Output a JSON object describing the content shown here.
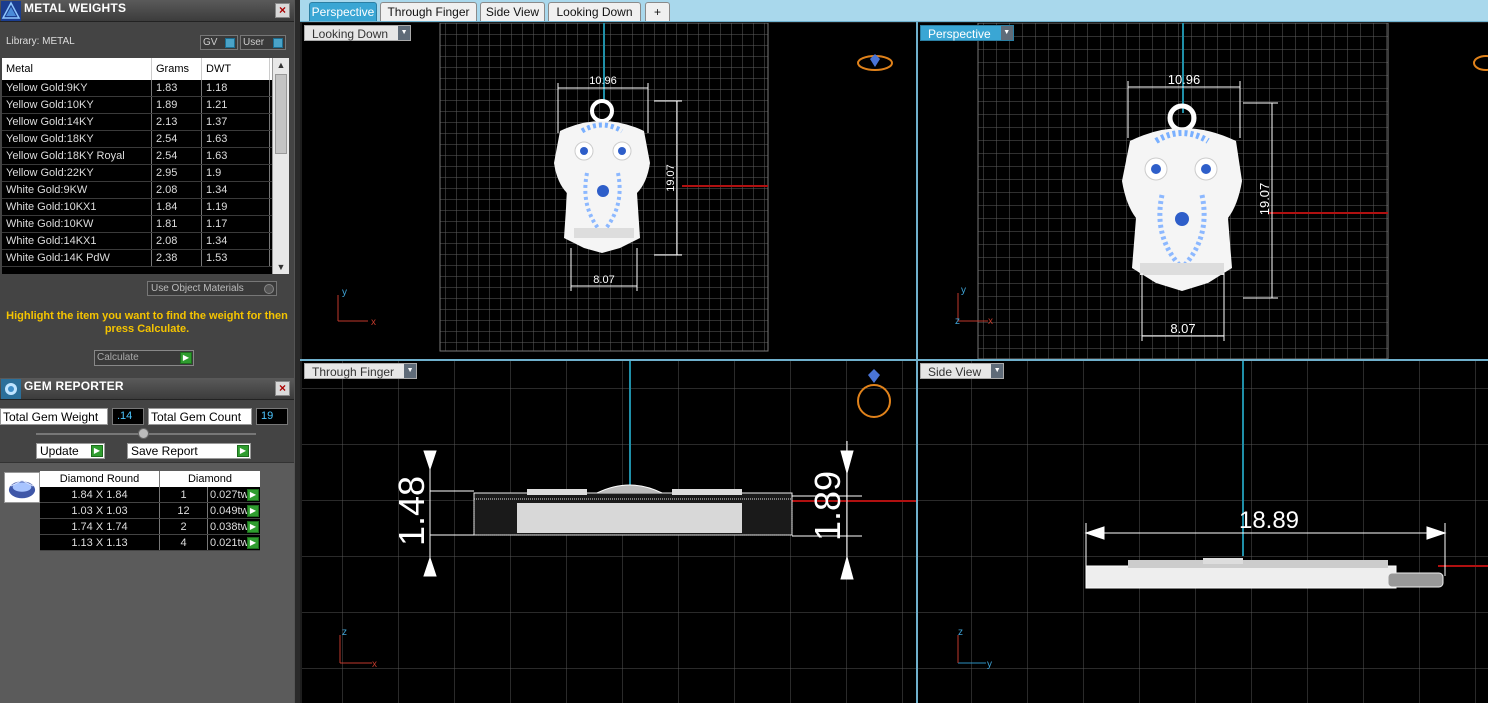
{
  "metal_panel": {
    "title": "METAL WEIGHTS",
    "library_label": "Library: METAL",
    "gv_label": "GV",
    "user_label": "User",
    "columns": [
      "Metal",
      "Grams",
      "DWT"
    ],
    "rows": [
      {
        "metal": "Yellow Gold:9KY",
        "grams": "1.83",
        "dwt": "1.18"
      },
      {
        "metal": "Yellow Gold:10KY",
        "grams": "1.89",
        "dwt": "1.21"
      },
      {
        "metal": "Yellow Gold:14KY",
        "grams": "2.13",
        "dwt": "1.37"
      },
      {
        "metal": "Yellow Gold:18KY",
        "grams": "2.54",
        "dwt": "1.63"
      },
      {
        "metal": "Yellow Gold:18KY Royal",
        "grams": "2.54",
        "dwt": "1.63"
      },
      {
        "metal": "Yellow Gold:22KY",
        "grams": "2.95",
        "dwt": "1.9"
      },
      {
        "metal": "White Gold:9KW",
        "grams": "2.08",
        "dwt": "1.34"
      },
      {
        "metal": "White Gold:10KX1",
        "grams": "1.84",
        "dwt": "1.19"
      },
      {
        "metal": "White Gold:10KW",
        "grams": "1.81",
        "dwt": "1.17"
      },
      {
        "metal": "White Gold:14KX1",
        "grams": "2.08",
        "dwt": "1.34"
      },
      {
        "metal": "White Gold:14K PdW",
        "grams": "2.38",
        "dwt": "1.53"
      }
    ],
    "use_object_materials": "Use Object Materials",
    "hint": "Highlight the item you want to find the weight for then press Calculate.",
    "calculate_label": "Calculate"
  },
  "gem_panel": {
    "title": "GEM REPORTER",
    "total_weight_label": "Total Gem Weight",
    "total_weight_value": ".14",
    "total_count_label": "Total Gem Count",
    "total_count_value": "19",
    "update_label": "Update",
    "save_report_label": "Save Report",
    "columns": [
      "Diamond Round",
      "Diamond"
    ],
    "rows": [
      {
        "size": "1.84 X 1.84",
        "count": "1",
        "weight": "0.027tw"
      },
      {
        "size": "1.03 X 1.03",
        "count": "12",
        "weight": "0.049tw"
      },
      {
        "size": "1.74 X 1.74",
        "count": "2",
        "weight": "0.038tw"
      },
      {
        "size": "1.13 X 1.13",
        "count": "4",
        "weight": "0.021tw"
      }
    ]
  },
  "tabs": [
    {
      "label": "Perspective",
      "active": true
    },
    {
      "label": "Through Finger",
      "active": false
    },
    {
      "label": "Side View",
      "active": false
    },
    {
      "label": "Looking Down",
      "active": false
    },
    {
      "label": "+",
      "active": false
    }
  ],
  "viewports": {
    "top_left": {
      "label": "Looking Down",
      "dims": {
        "width_top": "10.96",
        "height": "19.07",
        "width_bottom": "8.07"
      },
      "axes": [
        "y",
        "x"
      ]
    },
    "top_right": {
      "label": "Perspective",
      "dims": {
        "width_top": "10.96",
        "height": "19.07",
        "width_bottom": "8.07"
      },
      "axes": [
        "y",
        "z",
        "x"
      ]
    },
    "bottom_left": {
      "label": "Through Finger",
      "dims": {
        "left": "1.48",
        "right": "1.89"
      },
      "axes": [
        "z",
        "x"
      ]
    },
    "bottom_right": {
      "label": "Side View",
      "dims": {
        "length": "18.89"
      },
      "axes": [
        "z",
        "y"
      ]
    }
  }
}
